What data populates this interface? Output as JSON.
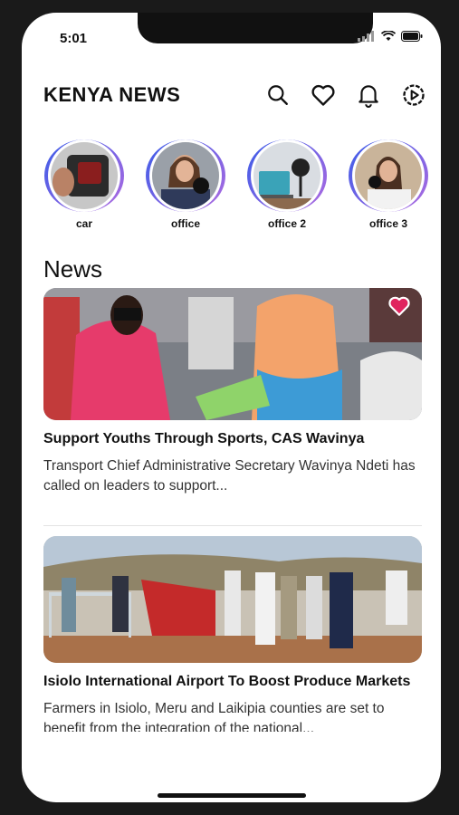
{
  "status_bar": {
    "time": "5:01"
  },
  "header": {
    "title": "KENYA NEWS"
  },
  "stories": [
    {
      "label": "car"
    },
    {
      "label": "office"
    },
    {
      "label": "office 2"
    },
    {
      "label": "office 3"
    }
  ],
  "section": {
    "title": "News"
  },
  "articles": [
    {
      "title": "Support Youths Through Sports, CAS Wavinya",
      "excerpt": "Transport Chief Administrative Secretary Wavinya Ndeti has called on leaders to support..."
    },
    {
      "title": "Isiolo International Airport To Boost Produce Markets",
      "excerpt": "Farmers in Isiolo, Meru and Laikipia counties are set to benefit from the integration of the national..."
    }
  ],
  "colors": {
    "ring_start": "#3a5ce8",
    "ring_end": "#b06be0",
    "favorite": "#e0245e"
  }
}
